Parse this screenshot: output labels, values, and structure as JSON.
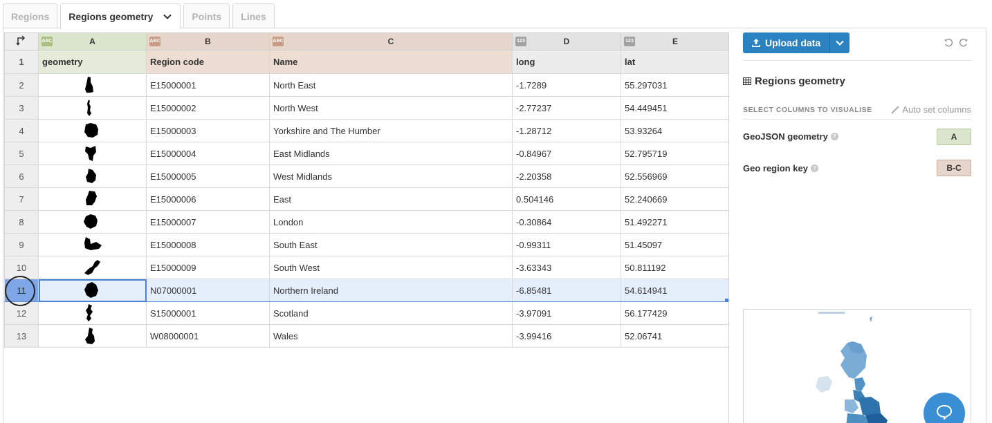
{
  "tabs": [
    {
      "label": "Regions",
      "active": false
    },
    {
      "label": "Regions geometry",
      "active": true
    },
    {
      "label": "Points",
      "active": false
    },
    {
      "label": "Lines",
      "active": false
    }
  ],
  "grid": {
    "columns": [
      {
        "letter": "A",
        "type_badge": "ABC",
        "header": "geometry",
        "kind": "geo"
      },
      {
        "letter": "B",
        "type_badge": "ABC",
        "header": "Region code",
        "kind": "reg"
      },
      {
        "letter": "C",
        "type_badge": "ABC",
        "header": "Name",
        "kind": "reg"
      },
      {
        "letter": "D",
        "type_badge": "123",
        "header": "long",
        "kind": "num"
      },
      {
        "letter": "E",
        "type_badge": "123",
        "header": "lat",
        "kind": "num"
      }
    ],
    "header_row_number": "1",
    "rows": [
      {
        "n": "2",
        "code": "E15000001",
        "name": "North East",
        "long": "-1.7289",
        "lat": "55.297031"
      },
      {
        "n": "3",
        "code": "E15000002",
        "name": "North West",
        "long": "-2.77237",
        "lat": "54.449451"
      },
      {
        "n": "4",
        "code": "E15000003",
        "name": "Yorkshire and The Humber",
        "long": "-1.28712",
        "lat": "53.93264"
      },
      {
        "n": "5",
        "code": "E15000004",
        "name": "East Midlands",
        "long": "-0.84967",
        "lat": "52.795719"
      },
      {
        "n": "6",
        "code": "E15000005",
        "name": "West Midlands",
        "long": "-2.20358",
        "lat": "52.556969"
      },
      {
        "n": "7",
        "code": "E15000006",
        "name": "East",
        "long": "0.504146",
        "lat": "52.240669"
      },
      {
        "n": "8",
        "code": "E15000007",
        "name": "London",
        "long": "-0.30864",
        "lat": "51.492271"
      },
      {
        "n": "9",
        "code": "E15000008",
        "name": "South East",
        "long": "-0.99311",
        "lat": "51.45097"
      },
      {
        "n": "10",
        "code": "E15000009",
        "name": "South West",
        "long": "-3.63343",
        "lat": "50.811192"
      },
      {
        "n": "11",
        "code": "N07000001",
        "name": "Northern Ireland",
        "long": "-6.85481",
        "lat": "54.614941"
      },
      {
        "n": "12",
        "code": "S15000001",
        "name": "Scotland",
        "long": "-3.97091",
        "lat": "56.177429"
      },
      {
        "n": "13",
        "code": "W08000001",
        "name": "Wales",
        "long": "-3.99416",
        "lat": "52.06741"
      }
    ],
    "selected_row": "11"
  },
  "panel": {
    "upload_label": "Upload data",
    "title": "Regions geometry",
    "select_label": "SELECT COLUMNS TO VISUALISE",
    "auto_set_label": "Auto set columns",
    "fields": [
      {
        "label": "GeoJSON geometry",
        "value": "A"
      },
      {
        "label": "Geo region key",
        "value": "B-C"
      }
    ]
  },
  "colors": {
    "accent": "#2b82c0",
    "geo_column": "#dbe5cb",
    "region_column": "#e7d6cb",
    "selection": "#e5eefb"
  },
  "icons": [
    "transpose-icon",
    "chevron-down-icon",
    "upload-icon",
    "undo-icon",
    "redo-icon",
    "table-icon",
    "wand-icon",
    "help-icon",
    "chat-icon"
  ]
}
